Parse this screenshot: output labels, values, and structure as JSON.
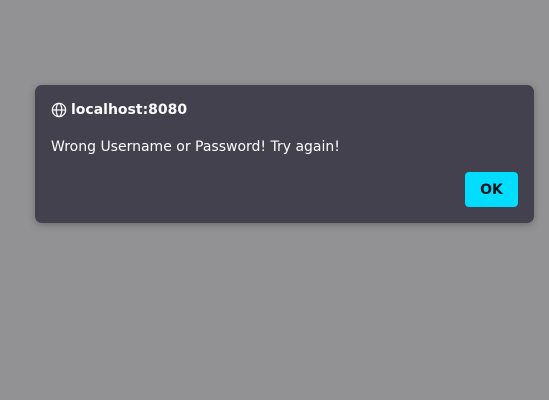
{
  "dialog": {
    "origin": "localhost:8080",
    "origin_icon": "globe-icon",
    "message": "Wrong Username or Password! Try again!",
    "ok_label": "OK"
  },
  "colors": {
    "backdrop": "#929294",
    "dialog_background": "#42414d",
    "text": "#fbfbfe",
    "button_accent": "#00ddff",
    "button_text": "#15141a"
  }
}
